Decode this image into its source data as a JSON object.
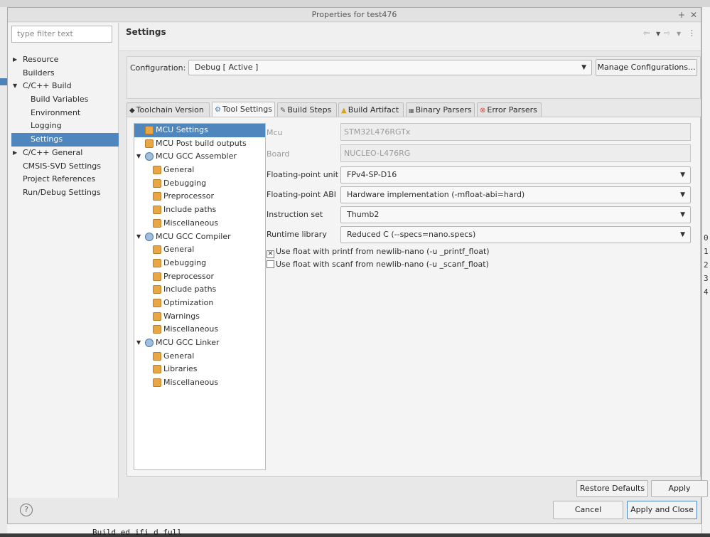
{
  "window_title": "Properties for test476",
  "filter_placeholder": "type filter text",
  "nav": [
    {
      "label": "Resource",
      "expand": "collapsed",
      "level": 0
    },
    {
      "label": "Builders",
      "expand": "none",
      "level": 0
    },
    {
      "label": "C/C++ Build",
      "expand": "expanded",
      "level": 0
    },
    {
      "label": "Build Variables",
      "expand": "none",
      "level": 1
    },
    {
      "label": "Environment",
      "expand": "none",
      "level": 1
    },
    {
      "label": "Logging",
      "expand": "none",
      "level": 1
    },
    {
      "label": "Settings",
      "expand": "none",
      "level": 1,
      "selected": true
    },
    {
      "label": "C/C++ General",
      "expand": "collapsed",
      "level": 0
    },
    {
      "label": "CMSIS-SVD Settings",
      "expand": "none",
      "level": 0
    },
    {
      "label": "Project References",
      "expand": "none",
      "level": 0
    },
    {
      "label": "Run/Debug Settings",
      "expand": "none",
      "level": 0
    }
  ],
  "page_title": "Settings",
  "configuration": {
    "label": "Configuration:",
    "value": "Debug  [ Active ]",
    "manage_button": "Manage Configurations..."
  },
  "tabs": [
    {
      "label": "Toolchain Version",
      "icon": "toolchain-icon"
    },
    {
      "label": "Tool Settings",
      "icon": "tool-settings-icon",
      "active": true
    },
    {
      "label": "Build Steps",
      "icon": "build-steps-icon"
    },
    {
      "label": "Build Artifact",
      "icon": "build-artifact-icon"
    },
    {
      "label": "Binary Parsers",
      "icon": "binary-parsers-icon"
    },
    {
      "label": "Error Parsers",
      "icon": "error-parsers-icon"
    }
  ],
  "tree": [
    {
      "label": "MCU Settings",
      "level": 0,
      "expand": "none",
      "kind": "page",
      "selected": true
    },
    {
      "label": "MCU Post build outputs",
      "level": 0,
      "expand": "none",
      "kind": "page"
    },
    {
      "label": "MCU GCC Assembler",
      "level": 0,
      "expand": "expanded",
      "kind": "tool"
    },
    {
      "label": "General",
      "level": 1,
      "expand": "none",
      "kind": "page"
    },
    {
      "label": "Debugging",
      "level": 1,
      "expand": "none",
      "kind": "page"
    },
    {
      "label": "Preprocessor",
      "level": 1,
      "expand": "none",
      "kind": "page"
    },
    {
      "label": "Include paths",
      "level": 1,
      "expand": "none",
      "kind": "page"
    },
    {
      "label": "Miscellaneous",
      "level": 1,
      "expand": "none",
      "kind": "page"
    },
    {
      "label": "MCU GCC Compiler",
      "level": 0,
      "expand": "expanded",
      "kind": "tool"
    },
    {
      "label": "General",
      "level": 1,
      "expand": "none",
      "kind": "page"
    },
    {
      "label": "Debugging",
      "level": 1,
      "expand": "none",
      "kind": "page"
    },
    {
      "label": "Preprocessor",
      "level": 1,
      "expand": "none",
      "kind": "page"
    },
    {
      "label": "Include paths",
      "level": 1,
      "expand": "none",
      "kind": "page"
    },
    {
      "label": "Optimization",
      "level": 1,
      "expand": "none",
      "kind": "page"
    },
    {
      "label": "Warnings",
      "level": 1,
      "expand": "none",
      "kind": "page"
    },
    {
      "label": "Miscellaneous",
      "level": 1,
      "expand": "none",
      "kind": "page"
    },
    {
      "label": "MCU GCC Linker",
      "level": 0,
      "expand": "expanded",
      "kind": "tool"
    },
    {
      "label": "General",
      "level": 1,
      "expand": "none",
      "kind": "page"
    },
    {
      "label": "Libraries",
      "level": 1,
      "expand": "none",
      "kind": "page"
    },
    {
      "label": "Miscellaneous",
      "level": 1,
      "expand": "none",
      "kind": "page"
    }
  ],
  "form": {
    "mcu": {
      "label": "Mcu",
      "value": "STM32L476RGTx"
    },
    "board": {
      "label": "Board",
      "value": "NUCLEO-L476RG"
    },
    "fpu": {
      "label": "Floating-point unit",
      "value": "FPv4-SP-D16"
    },
    "fabi": {
      "label": "Floating-point ABI",
      "value": "Hardware implementation (-mfloat-abi=hard)"
    },
    "iset": {
      "label": "Instruction set",
      "value": "Thumb2"
    },
    "rtlib": {
      "label": "Runtime library",
      "value": "Reduced C (--specs=nano.specs)"
    },
    "printf_float": {
      "label": "Use float with printf from newlib-nano (-u _printf_float)",
      "checked": true
    },
    "scanf_float": {
      "label": "Use float with scanf from newlib-nano (-u _scanf_float)",
      "checked": false
    }
  },
  "buttons": {
    "restore_defaults": "Restore Defaults",
    "apply": "Apply",
    "cancel": "Cancel",
    "apply_close": "Apply and Close"
  },
  "background": {
    "console_text": "Build  ed  ifi   d        full",
    "right_numbers": [
      "0",
      "1",
      "2",
      "3",
      "4"
    ]
  }
}
